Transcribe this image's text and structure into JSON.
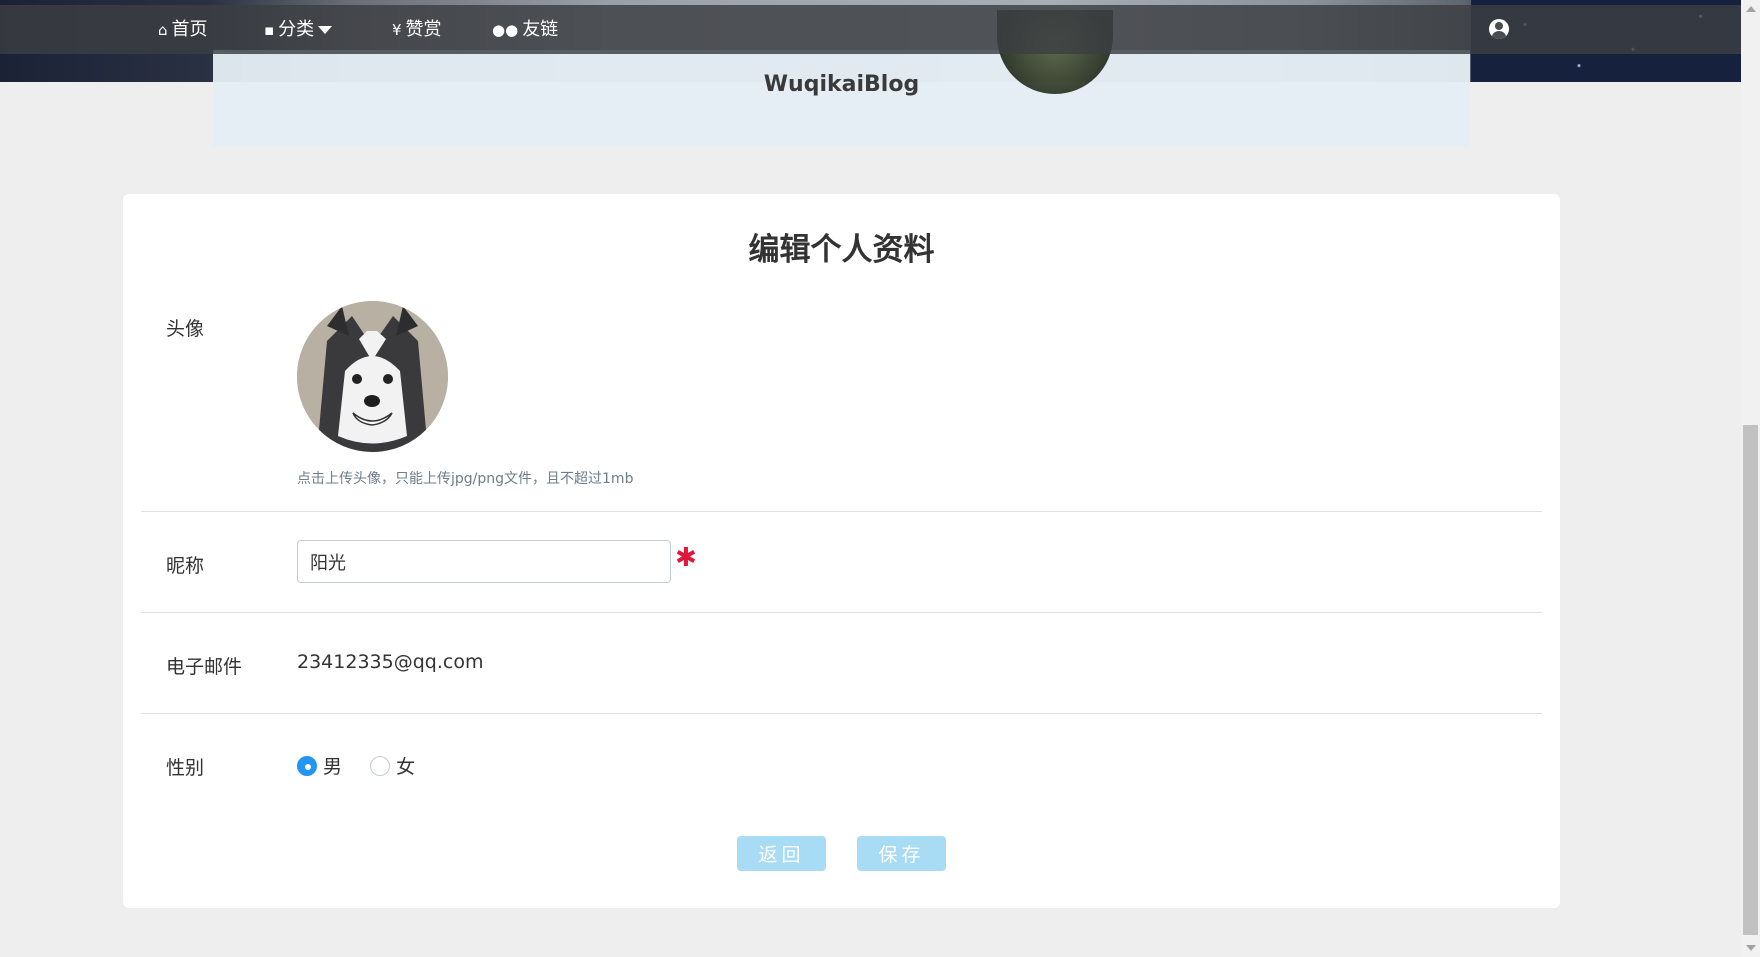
{
  "nav": {
    "home": "首页",
    "category": "分类",
    "reward": "赞赏",
    "friends": "友链",
    "reward_symbol": "¥"
  },
  "site": {
    "title": "WuqikaiBlog"
  },
  "form": {
    "title": "编辑个人资料",
    "avatar_label": "头像",
    "avatar_hint": "点击上传头像，只能上传jpg/png文件，且不超过1mb",
    "nickname_label": "昵称",
    "nickname_value": "阳光",
    "required_mark": "✱",
    "email_label": "电子邮件",
    "email_value": "23412335@qq.com",
    "gender_label": "性别",
    "gender_options": [
      "男",
      "女"
    ],
    "gender_selected": "男",
    "back_button": "返回",
    "save_button": "保存"
  },
  "colors": {
    "accent": "#2196f3",
    "button": "#a7dcf4",
    "required": "#e0193a"
  }
}
